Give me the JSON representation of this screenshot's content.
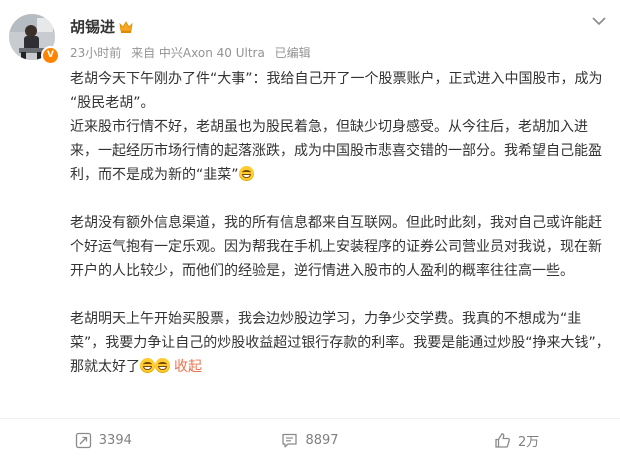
{
  "author": {
    "name": "胡锡进",
    "avatar_icon": "person-photo-icon",
    "verified_icon": "verified-v-icon",
    "badge_icon": "crown-icon"
  },
  "meta": {
    "time": "23小时前",
    "source": "来自 中兴Axon 40 Ultra",
    "edited": "已编辑"
  },
  "content": {
    "p1": "老胡今天下午刚办了件“大事”：我给自己开了一个股票账户，正式进入中国股市，成为 “股民老胡”。",
    "p2": "近来股市行情不好，老胡虽也为股民着急，但缺少切身感受。从今往后，老胡加入进来，一起经历市场行情的起落涨跌，成为中国股市悲喜交错的一部分。我希望自己能盈利，而不是成为新的“韭菜”",
    "p3": "老胡没有额外信息渠道，我的所有信息都来自互联网。但此时此刻，我对自己或许能赶个好运气抱有一定乐观。因为帮我在手机上安装程序的证券公司营业员对我说，现在新开户的人比较少，而他们的经验是，逆行情进入股市的人盈利的概率往往高一些。",
    "p4": "老胡明天上午开始买股票，我会边炒股边学习，力争少交学费。我真的不想成为“韭菜”，我要力争让自己的炒股收益超过银行存款的利率。我要是能通过炒股“挣来大钱”，那就太好了",
    "collapse": "收起",
    "emoji_icon": "grin-emoji-icon"
  },
  "actions": {
    "repost_count": "3394",
    "comment_count": "8897",
    "like_count": "2万"
  },
  "colors": {
    "text": "#333333",
    "meta": "#939393",
    "link": "#eb7350",
    "verified": "#ff8200"
  }
}
